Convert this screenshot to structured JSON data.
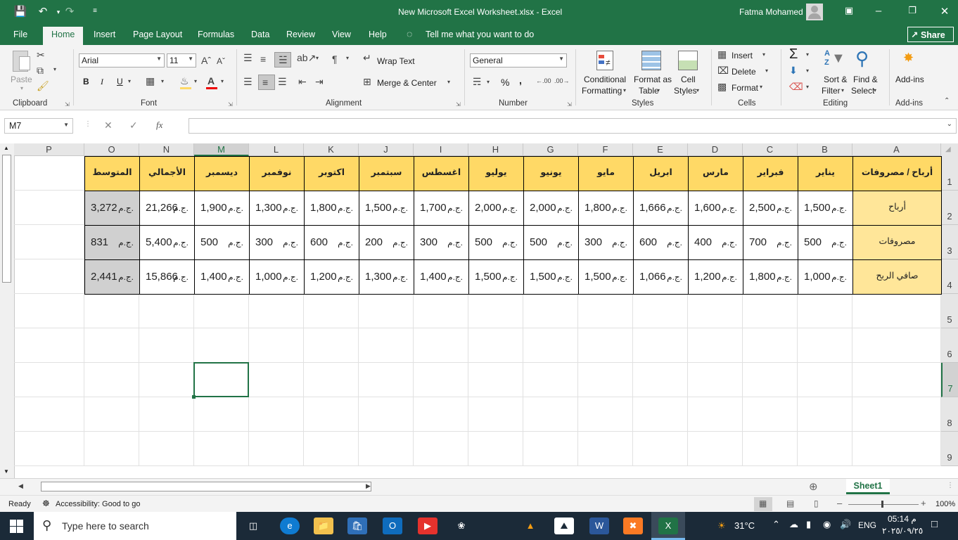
{
  "window": {
    "title": "New Microsoft Excel Worksheet.xlsx  -  Excel",
    "user": "Fatma Mohamed"
  },
  "menu_tabs": [
    "File",
    "Home",
    "Insert",
    "Page Layout",
    "Formulas",
    "Data",
    "Review",
    "View",
    "Help"
  ],
  "tell_me": "Tell me what you want to do",
  "share_label": "Share",
  "ribbon": {
    "clipboard": {
      "label": "Clipboard",
      "paste": "Paste"
    },
    "font": {
      "label": "Font",
      "name": "Arial",
      "size": "11",
      "bold": "B",
      "italic": "I",
      "underline": "U"
    },
    "alignment": {
      "label": "Alignment",
      "wrap": "Wrap Text",
      "merge": "Merge & Center"
    },
    "number": {
      "label": "Number",
      "format": "General",
      "percent": "%",
      "comma": ","
    },
    "styles": {
      "label": "Styles",
      "cond1": "Conditional",
      "cond2": "Formatting",
      "fmt1": "Format as",
      "fmt2": "Table",
      "cs1": "Cell",
      "cs2": "Styles"
    },
    "cells": {
      "label": "Cells",
      "insert": "Insert",
      "delete": "Delete",
      "format": "Format"
    },
    "editing": {
      "label": "Editing",
      "sort1": "Sort &",
      "sort2": "Filter",
      "find1": "Find &",
      "find2": "Select",
      "sum": "Σ"
    },
    "addins": {
      "label": "Add-ins",
      "btn": "Add-ins"
    }
  },
  "formula_bar": {
    "name_box": "M7",
    "fx": "fx",
    "content": ""
  },
  "columns": [
    "A",
    "B",
    "C",
    "D",
    "E",
    "F",
    "G",
    "H",
    "I",
    "J",
    "K",
    "L",
    "M",
    "N",
    "O",
    "P"
  ],
  "rows": [
    "1",
    "2",
    "3",
    "4",
    "5",
    "6",
    "7",
    "8",
    "9"
  ],
  "selected_cell": {
    "column": "M",
    "row": "7"
  },
  "table": {
    "header": [
      "أرباح  / مصروفات",
      "يناير",
      "فبراير",
      "مارس",
      "ابريل",
      "مايو",
      "يونيو",
      "يوليو",
      "اغسطس",
      "سبتمبر",
      "اكتوبر",
      "نوفمبر",
      "ديسمبر",
      "الأجمالي",
      "المتوسط"
    ],
    "currency": "ج.م.",
    "rows": [
      {
        "label": "أرباح",
        "values": [
          "1,500",
          "2,500",
          "1,600",
          "1,666",
          "1,800",
          "2,000",
          "2,000",
          "1,700",
          "1,500",
          "1,800",
          "1,300",
          "1,900",
          "21,266",
          "3,272"
        ]
      },
      {
        "label": "مصروفات",
        "values": [
          "500",
          "700",
          "400",
          "600",
          "300",
          "500",
          "500",
          "300",
          "200",
          "600",
          "300",
          "500",
          "5,400",
          "831"
        ]
      },
      {
        "label": "صافي الربح",
        "values": [
          "1,000",
          "1,800",
          "1,200",
          "1,066",
          "1,500",
          "1,500",
          "1,500",
          "1,400",
          "1,300",
          "1,200",
          "1,000",
          "1,400",
          "15,866",
          "2,441"
        ]
      }
    ]
  },
  "sheet_tab": "Sheet1",
  "status": {
    "ready": "Ready",
    "accessibility": "Accessibility: Good to go",
    "zoom": "100%"
  },
  "taskbar": {
    "search": "Type here to search",
    "temp": "31°C",
    "lang": "ENG",
    "time": "م 05:14",
    "date": "٢٠٢٥/٠٩/٢٥"
  },
  "colors": {
    "excel_green": "#217346",
    "header_fill": "#ffd966",
    "label_fill": "#ffe699",
    "avg_fill": "#d0d0d0"
  }
}
